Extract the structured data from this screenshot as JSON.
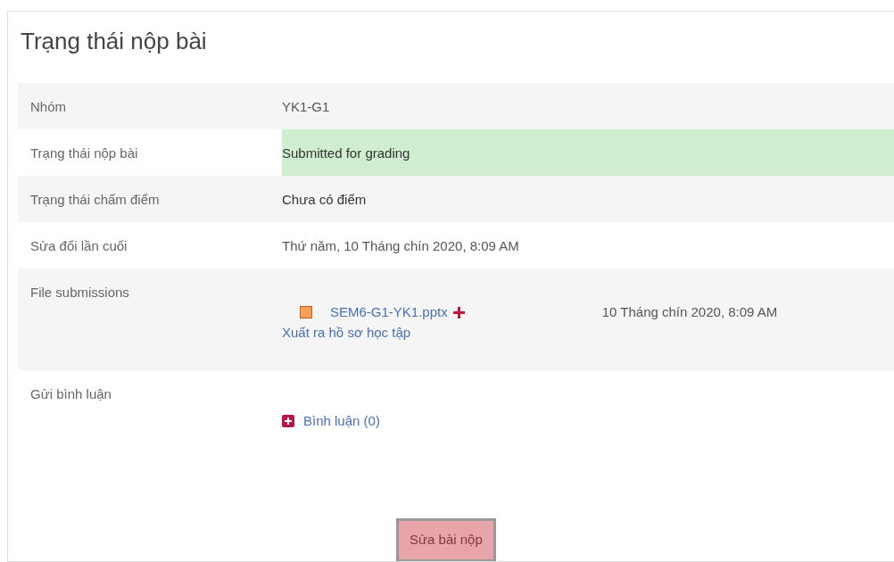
{
  "title": "Trạng thái nộp bài",
  "rows": [
    {
      "kind": "text",
      "label": "Nhóm",
      "value": "YK1-G1",
      "highlight": false,
      "dark": false
    },
    {
      "kind": "text",
      "label": "Trạng thái nộp bài",
      "value": "Submitted for grading",
      "highlight": true,
      "dark": true
    },
    {
      "kind": "text",
      "label": "Trạng thái chấm điểm",
      "value": "Chưa có điểm",
      "highlight": false,
      "dark": true
    },
    {
      "kind": "text",
      "label": "Sửa đổi lần cuối",
      "value": "Thứ năm, 10 Tháng chín 2020, 8:09 AM",
      "highlight": false,
      "dark": false
    },
    {
      "kind": "files",
      "label": "File submissions",
      "files": [
        {
          "name": "SEM6-G1-YK1.pptx",
          "date": "10 Tháng chín 2020, 8:09 AM"
        }
      ],
      "export_link": "Xuất ra hồ sơ học tập"
    },
    {
      "kind": "comments",
      "label": "Gửi bình luận",
      "link": "Bình luận (0)"
    }
  ],
  "button": "Sửa bài nộp"
}
